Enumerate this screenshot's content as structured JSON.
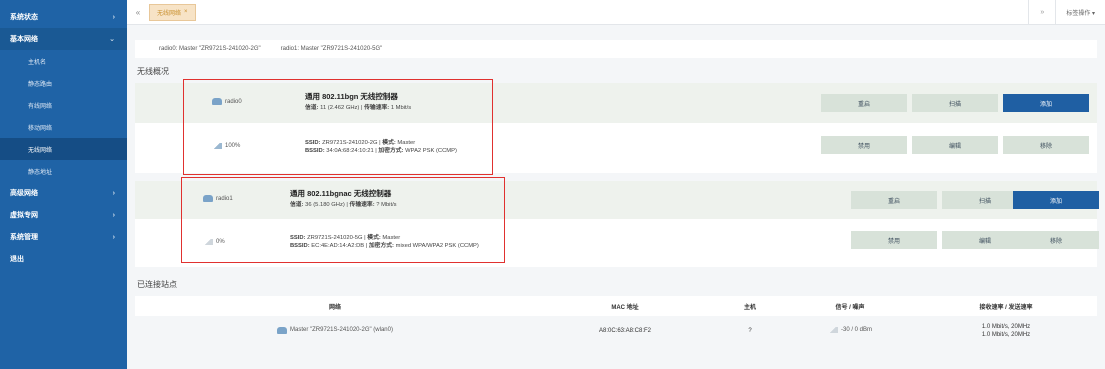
{
  "sidebar": {
    "items": [
      {
        "label": "系统状态",
        "chev": "›"
      },
      {
        "label": "基本网络",
        "chev": "⌄"
      },
      {
        "label": "高级网络",
        "chev": "›"
      },
      {
        "label": "虚拟专网",
        "chev": "›"
      },
      {
        "label": "系统管理",
        "chev": "›"
      },
      {
        "label": "退出"
      }
    ],
    "subitems": [
      "主机名",
      "静态路由",
      "有线网络",
      "移动网络",
      "无线网络",
      "静态地址"
    ]
  },
  "topbar": {
    "back": "«",
    "tab_label": "无线网络",
    "tab_close": "×",
    "forward": "»",
    "menu": "标签操作 ▾"
  },
  "radios": {
    "radio0": "radio0: Master \"ZR9721S-241020-2G\"",
    "radio1": "radio1: Master \"ZR9721S-241020-5G\""
  },
  "overview_title": "无线概况",
  "devices": [
    {
      "badge": "radio0",
      "title": "通用 802.11bgn 无线控制器",
      "channel_label": "信道:",
      "channel_value": "11 (2.462 GHz)",
      "rate_label": "传输速率:",
      "rate_value": "1 Mbit/s",
      "buttons": [
        "重启",
        "扫描",
        "添加"
      ],
      "net": {
        "signal": "100%",
        "ssid_label": "SSID:",
        "ssid": "ZR9721S-241020-2G",
        "mode_label": "模式:",
        "mode": "Master",
        "bssid_label": "BSSID:",
        "bssid": "34:0A:68:24:10:21",
        "enc_label": "加密方式:",
        "enc": "WPA2 PSK (CCMP)",
        "buttons": [
          "禁用",
          "编辑",
          "移除"
        ]
      }
    },
    {
      "badge": "radio1",
      "title": "通用 802.11bgnac 无线控制器",
      "channel_label": "信道:",
      "channel_value": "36 (5.180 GHz)",
      "rate_label": "传输速率:",
      "rate_value": "? Mbit/s",
      "buttons": [
        "重启",
        "扫描",
        "添加"
      ],
      "net": {
        "signal": "0%",
        "ssid_label": "SSID:",
        "ssid": "ZR9721S-241020-5G",
        "mode_label": "模式:",
        "mode": "Master",
        "bssid_label": "BSSID:",
        "bssid": "EC:4E:AD:14:A2:DB",
        "enc_label": "加密方式:",
        "enc": "mixed WPA/WPA2 PSK (CCMP)",
        "buttons": [
          "禁用",
          "编辑",
          "移除"
        ]
      }
    }
  ],
  "stations_title": "已连接站点",
  "stations": {
    "headers": [
      "网络",
      "MAC 地址",
      "主机",
      "信号 / 噪声",
      "接收速率 / 发送速率"
    ],
    "rows": [
      {
        "network": "Master \"ZR9721S-241020-2G\" (wlan0)",
        "mac": "A8:0C:63:A8:C8:F2",
        "host": "?",
        "signal": "-30 / 0 dBm",
        "rx": "1.0 Mbit/s, 20MHz",
        "tx": "1.0 Mbit/s, 20MHz"
      }
    ]
  },
  "colors": {
    "sidebar": "#1f63a6",
    "primary_button": "#1f5fa3",
    "highlight_box": "#e0312f"
  }
}
